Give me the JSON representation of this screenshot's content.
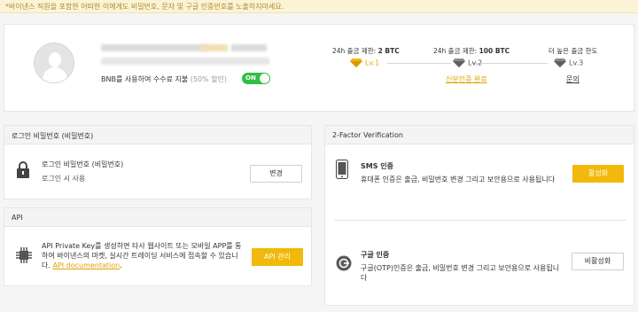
{
  "notice": "*바이낸스 직원을 포함한 어떠한 이에게도 비밀번호, 문자 및 구글 인증번호를 노출하지마세요.",
  "profile": {
    "bnb_fee_label": "BNB를 사용하여 수수료 지불",
    "bnb_discount": "(50% 할인)",
    "toggle_label": "ON",
    "levels": [
      {
        "limit_prefix": "24h 출금 제한: ",
        "limit_value": "2 BTC",
        "level": "Lv.1",
        "link": "",
        "icon": "gold-diamond-icon",
        "color": "#e8a300"
      },
      {
        "limit_prefix": "24h 출금 제한: ",
        "limit_value": "100 BTC",
        "level": "Lv.2",
        "link": "신분인증 완료",
        "icon": "grey-diamond-icon",
        "color": "#555555"
      },
      {
        "limit_prefix": "더 높은 출금 한도",
        "limit_value": "",
        "level": "Lv.3",
        "link": "문의",
        "icon": "grey-diamond-icon",
        "color": "#555555"
      }
    ]
  },
  "login_password": {
    "header": "로그인 비밀번호 (비밀번호)",
    "title": "로그인 비밀번호 (비밀번호)",
    "desc": "로그인 시 사용",
    "button": "변경"
  },
  "api": {
    "header": "API",
    "desc": "API Private Key를 생성하면 타사 웹사이트 또는 모바일 APP를 통하여 바이낸스의 마켓, 실시간 트레이딩 서비스에 접속할 수 있습니다.",
    "link": "API documentation",
    "link_suffix": ".",
    "button": "API 관리"
  },
  "two_factor": {
    "header": "2-Factor Verification",
    "sms": {
      "title": "SMS 인증",
      "desc": "휴대폰 인증은 출금, 비밀번호 변경 그리고 보안용으로 사용됩니다",
      "button": "활성화"
    },
    "google": {
      "title": "구글 인증",
      "desc": "구글(OTP)인증은 출금, 비밀번호 변경 그리고 보안용으로 사용됩니다",
      "button": "비활성화"
    }
  },
  "colors": {
    "accent": "#f0b90b",
    "toggle_on": "#2fbf45",
    "notice_bg": "#fbf3d6"
  }
}
